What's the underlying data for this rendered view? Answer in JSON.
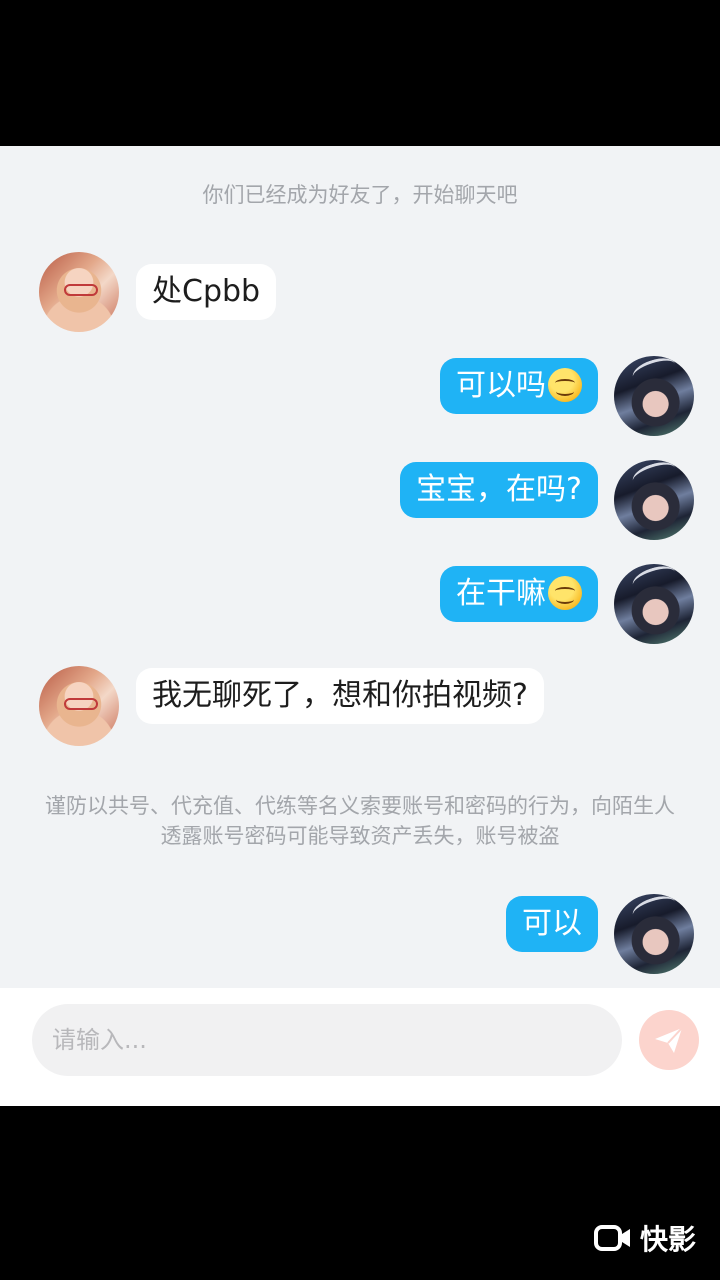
{
  "system": {
    "friend_notice": "你们已经成为好友了，开始聊天吧",
    "security_warning": "谨防以共号、代充值、代练等名义索要账号和密码的行为，向陌生人透露账号密码可能导致资产丢失，账号被盗"
  },
  "messages": [
    {
      "sender": "friend",
      "text": "处Cpbb"
    },
    {
      "sender": "me",
      "text": "可以吗",
      "emoji": "smiling-face"
    },
    {
      "sender": "me",
      "text": "宝宝，在吗?"
    },
    {
      "sender": "me",
      "text": "在干嘛",
      "emoji": "smiling-face"
    },
    {
      "sender": "friend",
      "text": "我无聊死了，想和你拍视频?"
    },
    {
      "sender": "me",
      "text": "可以"
    }
  ],
  "input": {
    "placeholder": "请输入...",
    "value": ""
  },
  "watermark": {
    "text": "快影",
    "icon": "video-camera-icon"
  },
  "colors": {
    "my_bubble": "#1fb3f5",
    "friend_bubble": "#ffffff",
    "chat_background": "#f1f3f5",
    "send_button": "#fcd4cd"
  }
}
